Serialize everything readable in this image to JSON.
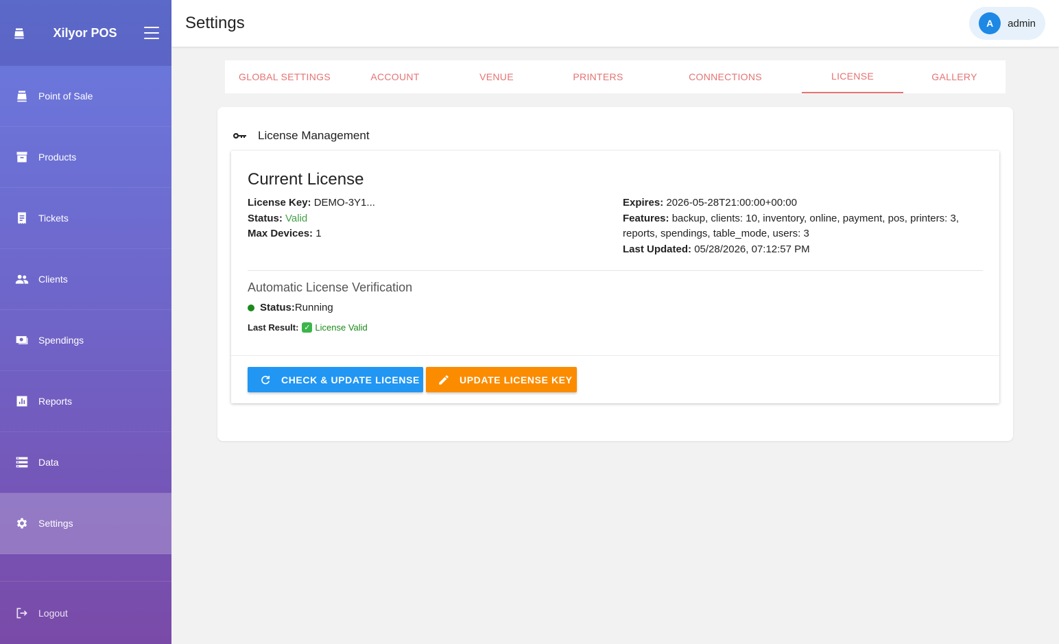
{
  "app": {
    "name": "Xilyor POS"
  },
  "nav": {
    "items": [
      {
        "label": "Point of Sale",
        "icon": "cash-register-icon"
      },
      {
        "label": "Products",
        "icon": "archive-icon"
      },
      {
        "label": "Tickets",
        "icon": "receipt-icon"
      },
      {
        "label": "Clients",
        "icon": "people-icon"
      },
      {
        "label": "Spendings",
        "icon": "money-icon"
      },
      {
        "label": "Reports",
        "icon": "chart-icon"
      },
      {
        "label": "Data",
        "icon": "storage-icon"
      },
      {
        "label": "Settings",
        "icon": "gear-icon"
      }
    ],
    "active": "Settings",
    "logout": "Logout"
  },
  "header": {
    "title": "Settings",
    "user": {
      "initial": "A",
      "name": "admin"
    }
  },
  "tabs": [
    {
      "label": "GLOBAL SETTINGS"
    },
    {
      "label": "ACCOUNT"
    },
    {
      "label": "VENUE"
    },
    {
      "label": "PRINTERS"
    },
    {
      "label": "CONNECTIONS"
    },
    {
      "label": "LICENSE"
    },
    {
      "label": "GALLERY"
    }
  ],
  "license": {
    "section_title": "License Management",
    "heading": "Current License",
    "key_label": "License Key:",
    "key_value": "DEMO-3Y1...",
    "status_label": "Status:",
    "status_value": "Valid",
    "max_devices_label": "Max Devices:",
    "max_devices_value": "1",
    "expires_label": "Expires:",
    "expires_value": "2026-05-28T21:00:00+00:00",
    "features_label": "Features:",
    "features_value": "backup, clients: 10, inventory, online, payment, pos, printers: 3, reports, spendings, table_mode, users: 3",
    "updated_label": "Last Updated:",
    "updated_value": "05/28/2026, 07:12:57 PM",
    "auto_title": "Automatic License Verification",
    "auto_status_label": "Status:",
    "auto_status_value": "Running",
    "last_result_label": "Last Result:",
    "last_result_value": "License Valid",
    "check_button": "CHECK & UPDATE LICENSE",
    "update_button": "UPDATE LICENSE KEY"
  },
  "colors": {
    "accent": "#e57373",
    "primary": "#2196f3",
    "warning": "#fb8c00",
    "success": "#43a047"
  }
}
